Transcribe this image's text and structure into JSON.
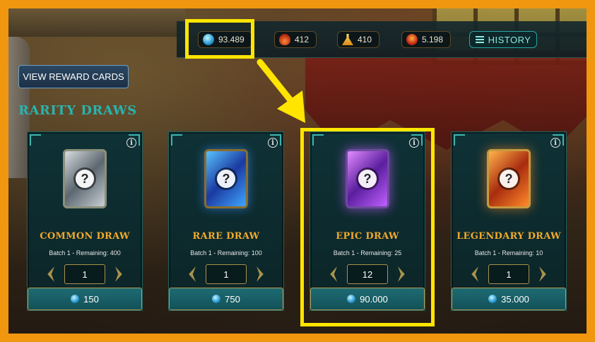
{
  "topbar": {
    "resources": [
      {
        "name": "dec",
        "icon": "dec-crystal-icon",
        "value": "93.489"
      },
      {
        "name": "potion",
        "icon": "potion-icon",
        "value": "412"
      },
      {
        "name": "legendary-potion",
        "icon": "legendary-potion-icon",
        "value": "410"
      },
      {
        "name": "sps",
        "icon": "sps-token-icon",
        "value": "5.198"
      }
    ],
    "history_label": "HISTORY"
  },
  "view_reward_cards_label": "VIEW REWARD CARDS",
  "section_title": "RARITY DRAWS",
  "draws": [
    {
      "title": "COMMON DRAW",
      "batch": "Batch 1 - Remaining: 400",
      "quantity": "1",
      "price": "150"
    },
    {
      "title": "RARE DRAW",
      "batch": "Batch 1 - Remaining: 100",
      "quantity": "1",
      "price": "750"
    },
    {
      "title": "EPIC DRAW",
      "batch": "Batch 1 - Remaining: 25",
      "quantity": "12",
      "price": "90.000"
    },
    {
      "title": "LEGENDARY DRAW",
      "batch": "Batch 1 - Remaining: 10",
      "quantity": "1",
      "price": "35.000"
    }
  ],
  "colors": {
    "highlight": "#ffe500",
    "border_orange": "#f0960f",
    "teal_accent": "#2ab3ad",
    "draw_title": "#f0a92c"
  }
}
